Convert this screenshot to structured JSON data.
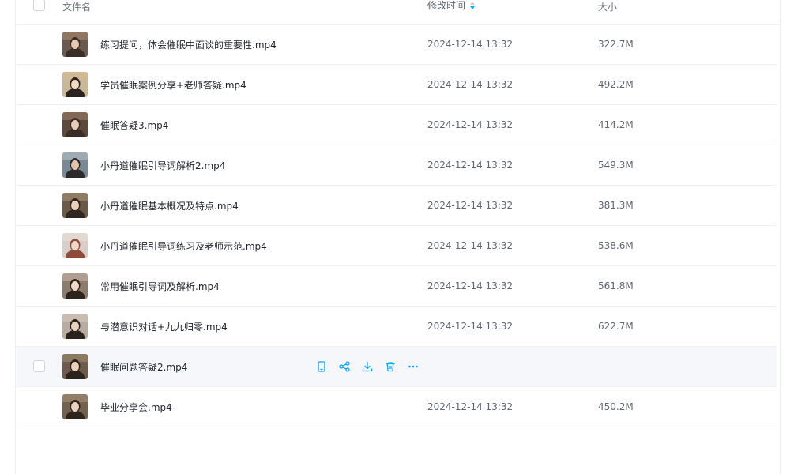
{
  "header": {
    "name_label": "文件名",
    "mtime_label": "修改时间",
    "size_label": "大小"
  },
  "colors": {
    "accent": "#06a7ff",
    "hover_row": "#f5f7fa",
    "text": "#1f2329",
    "muted": "#5f6670"
  },
  "files": [
    {
      "name": "练习提问，体会催眠中面谈的重要性.mp4",
      "mtime": "2024-12-14 13:32",
      "size": "322.7M"
    },
    {
      "name": "学员催眠案例分享+老师答疑.mp4",
      "mtime": "2024-12-14 13:32",
      "size": "492.2M"
    },
    {
      "name": "催眠答疑3.mp4",
      "mtime": "2024-12-14 13:32",
      "size": "414.2M"
    },
    {
      "name": "小丹道催眠引导词解析2.mp4",
      "mtime": "2024-12-14 13:32",
      "size": "549.3M"
    },
    {
      "name": "小丹道催眠基本概况及特点.mp4",
      "mtime": "2024-12-14 13:32",
      "size": "381.3M"
    },
    {
      "name": "小丹道催眠引导词练习及老师示范.mp4",
      "mtime": "2024-12-14 13:32",
      "size": "538.6M"
    },
    {
      "name": "常用催眠引导词及解析.mp4",
      "mtime": "2024-12-14 13:32",
      "size": "561.8M"
    },
    {
      "name": "与潜意识对话+九九归零.mp4",
      "mtime": "2024-12-14 13:32",
      "size": "622.7M"
    },
    {
      "name": "催眠问题答疑2.mp4",
      "mtime": "",
      "size": "",
      "hovered": true
    },
    {
      "name": "毕业分享会.mp4",
      "mtime": "2024-12-14 13:32",
      "size": "450.2M"
    }
  ],
  "hover_actions": [
    "phone-icon",
    "share-icon",
    "download-icon",
    "trash-icon",
    "more-icon"
  ]
}
